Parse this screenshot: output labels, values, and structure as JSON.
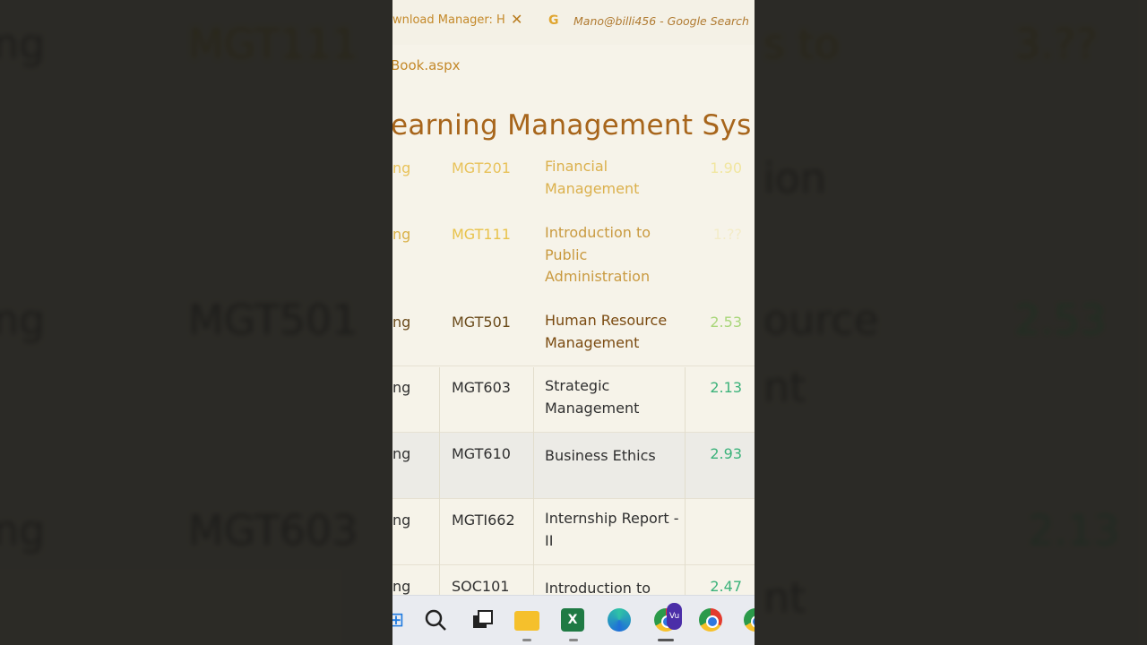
{
  "browser": {
    "tab1_label": "wnload Manager: H",
    "tab2_label": "Mano@billi456 - Google Search",
    "address_fragment": "Book.aspx"
  },
  "page": {
    "title": "earning Management Sys"
  },
  "table": {
    "rows": [
      {
        "c0": "ng",
        "code": "MGT201",
        "title": "Financial Management",
        "gpa": "1.90"
      },
      {
        "c0": "ng",
        "code": "MGT111",
        "title": "Introduction to Public Administration",
        "gpa": "1.??"
      },
      {
        "c0": "ng",
        "code": "MGT501",
        "title": "Human Resource Management",
        "gpa": "2.53"
      },
      {
        "c0": "ng",
        "code": "MGT603",
        "title": "Strategic Management",
        "gpa": "2.13"
      },
      {
        "c0": "ng",
        "code": "MGT610",
        "title": "Business Ethics",
        "gpa": "2.93"
      },
      {
        "c0": "ng",
        "code": "MGTI662",
        "title": "Internship Report - II",
        "gpa": ""
      },
      {
        "c0": "ng",
        "code": "SOC101",
        "title": "Introduction to",
        "gpa": "2.47"
      }
    ]
  },
  "backdrop": {
    "left": [
      "ng",
      "MGT111",
      "ng",
      "MGT501",
      "ng",
      "MGT603"
    ],
    "right": [
      "s to",
      "3.??",
      "ion",
      "ource",
      "2.53",
      "nt",
      "2.13",
      "nt"
    ]
  },
  "taskbar": {
    "excel_letter": "X",
    "vu_badge": "Vu"
  },
  "colors": {
    "title": "#a7651b",
    "gpa_green": "#3bb27a",
    "taskbar": "#e9ebf0"
  }
}
